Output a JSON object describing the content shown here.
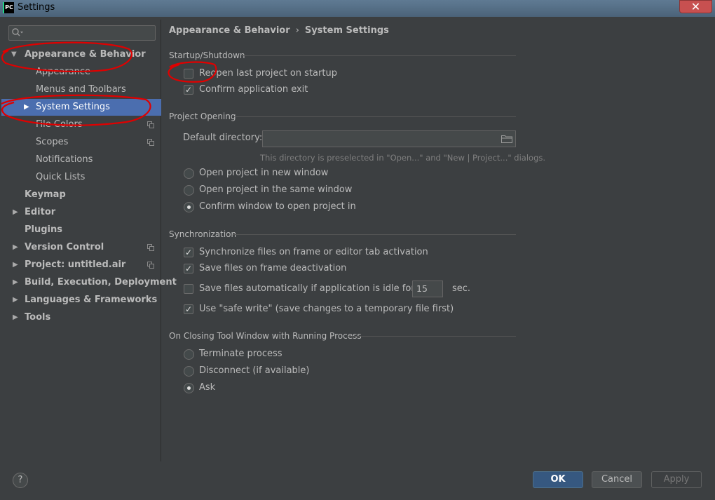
{
  "window": {
    "title": "Settings",
    "app_icon_label": "PC",
    "close_glyph": "✕"
  },
  "sidebar": {
    "search": {
      "placeholder": "",
      "value": ""
    },
    "items": [
      {
        "label": "Appearance & Behavior",
        "level": 0,
        "expanded": true,
        "bold": true
      },
      {
        "label": "Appearance",
        "level": 1
      },
      {
        "label": "Menus and Toolbars",
        "level": 1
      },
      {
        "label": "System Settings",
        "level": 1,
        "selected": true,
        "collapsed": true
      },
      {
        "label": "File Colors",
        "level": 1,
        "copy_icon": true
      },
      {
        "label": "Scopes",
        "level": 1,
        "copy_icon": true
      },
      {
        "label": "Notifications",
        "level": 1
      },
      {
        "label": "Quick Lists",
        "level": 1
      },
      {
        "label": "Keymap",
        "level": 0,
        "bold": true
      },
      {
        "label": "Editor",
        "level": 0,
        "bold": true,
        "collapsed": true
      },
      {
        "label": "Plugins",
        "level": 0,
        "bold": true
      },
      {
        "label": "Version Control",
        "level": 0,
        "bold": true,
        "collapsed": true,
        "copy_icon": true
      },
      {
        "label": "Project: untitled.air",
        "level": 0,
        "bold": true,
        "collapsed": true,
        "copy_icon": true
      },
      {
        "label": "Build, Execution, Deployment",
        "level": 0,
        "bold": true,
        "collapsed": true
      },
      {
        "label": "Languages & Frameworks",
        "level": 0,
        "bold": true,
        "collapsed": true
      },
      {
        "label": "Tools",
        "level": 0,
        "bold": true,
        "collapsed": true
      }
    ]
  },
  "breadcrumb": {
    "parent": "Appearance & Behavior",
    "separator": "›",
    "current": "System Settings"
  },
  "startup": {
    "title": "Startup/Shutdown",
    "reopen": {
      "label": "Reopen last project on startup",
      "checked": false
    },
    "confirm_exit": {
      "label": "Confirm application exit",
      "checked": true
    }
  },
  "project_opening": {
    "title": "Project Opening",
    "default_dir_label": "Default directory:",
    "default_dir_value": "",
    "hint": "This directory is preselected in \"Open...\" and \"New | Project...\" dialogs.",
    "new_window": {
      "label": "Open project in new window",
      "selected": false
    },
    "same_window": {
      "label": "Open project in the same window",
      "selected": false
    },
    "confirm_window": {
      "label": "Confirm window to open project in",
      "selected": true
    }
  },
  "sync": {
    "title": "Synchronization",
    "sync_files": {
      "label": "Synchronize files on frame or editor tab activation",
      "checked": true
    },
    "save_deactivation": {
      "label": "Save files on frame deactivation",
      "checked": true
    },
    "save_idle": {
      "label": "Save files automatically if application is idle for",
      "checked": false
    },
    "idle_value": "15",
    "idle_unit": "sec.",
    "safe_write": {
      "label": "Use \"safe write\" (save changes to a temporary file first)",
      "checked": true
    }
  },
  "closing": {
    "title": "On Closing Tool Window with Running Process",
    "terminate": {
      "label": "Terminate process",
      "selected": false
    },
    "disconnect": {
      "label": "Disconnect (if available)",
      "selected": false
    },
    "ask": {
      "label": "Ask",
      "selected": true
    }
  },
  "footer": {
    "help_label": "?",
    "ok_label": "OK",
    "cancel_label": "Cancel",
    "apply_label": "Apply"
  },
  "colors": {
    "background": "#3c3f41",
    "selection": "#4b6eaf",
    "ok_button": "#365880",
    "annotation": "#e00000"
  }
}
